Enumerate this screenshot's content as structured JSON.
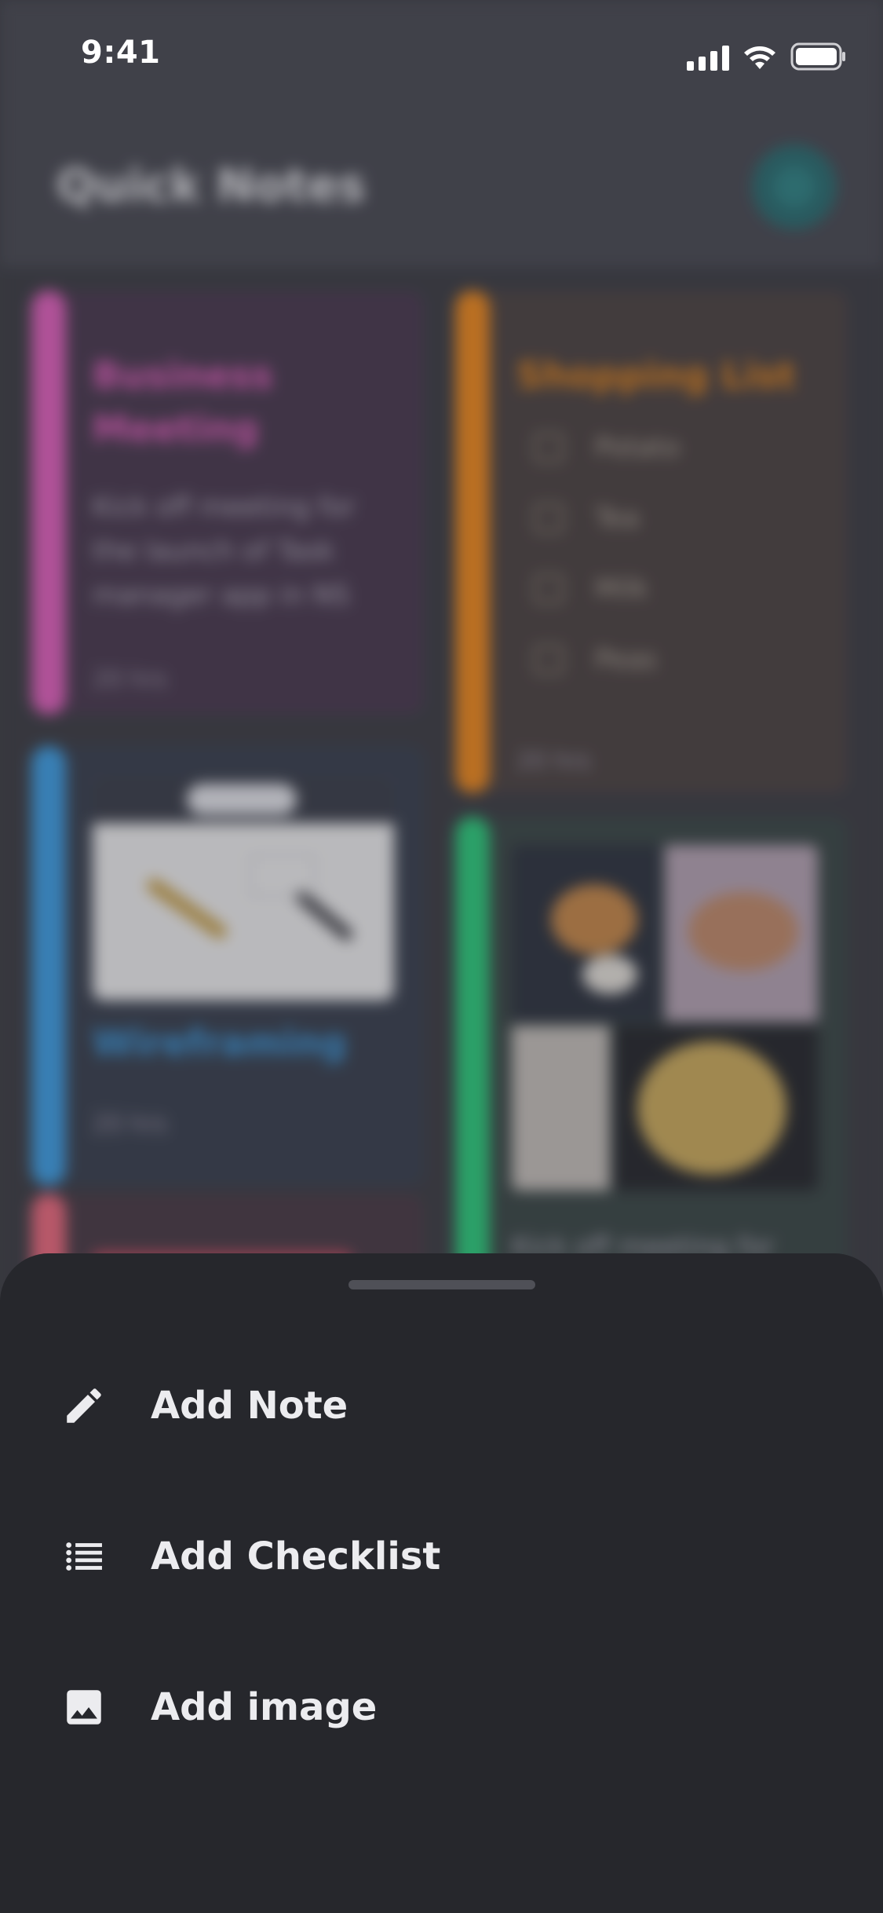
{
  "status_bar": {
    "time": "9:41",
    "icons": [
      "signal-icon",
      "wifi-icon",
      "battery-icon"
    ]
  },
  "app": {
    "title": "Quick Notes",
    "add_icon": "plus-icon"
  },
  "notes": [
    {
      "title_lines": [
        "Business",
        "Meeting"
      ],
      "body_lines": [
        "Kick off meeting for",
        "the launch of Task",
        "manager app in NS"
      ],
      "time": "20 hrs",
      "accent": "#e462c0",
      "bg": "#4a3a50"
    },
    {
      "title": "Shopping List",
      "items": [
        "Potato",
        "Tea",
        "Milk",
        "Peas"
      ],
      "time": "20 hrs",
      "accent": "#f28b1e",
      "bg": "#4d4443"
    },
    {
      "title": "Wireframing",
      "time": "20 hrs",
      "image": "wireframe-sketch-image",
      "accent": "#3fa1e8",
      "bg": "#3a4150"
    },
    {
      "image": "food-collage-image",
      "body": "Kick off meeting for",
      "accent": "#2dcf7e",
      "bg": "#3b4847"
    },
    {
      "accent": "#ef6b80",
      "bg": "#4a3b46"
    }
  ],
  "sheet": {
    "items": [
      {
        "label": "Add Note",
        "icon": "pencil-icon"
      },
      {
        "label": "Add Checklist",
        "icon": "list-icon"
      },
      {
        "label": "Add image",
        "icon": "image-icon"
      }
    ]
  }
}
